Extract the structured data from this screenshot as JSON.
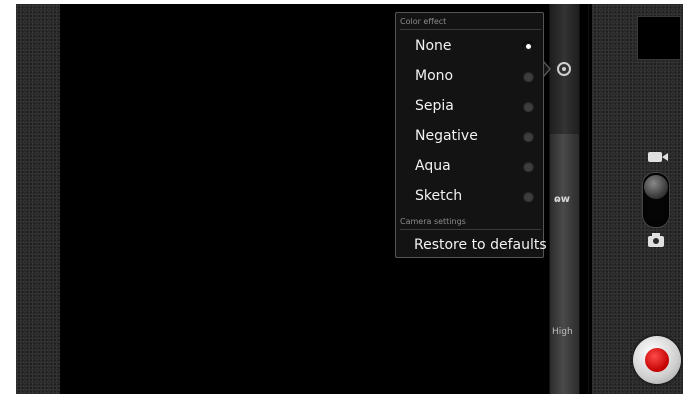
{
  "menu": {
    "section_color_effect": "Color effect",
    "color_effects": [
      {
        "label": "None",
        "selected": true
      },
      {
        "label": "Mono",
        "selected": false
      },
      {
        "label": "Sepia",
        "selected": false
      },
      {
        "label": "Negative",
        "selected": false
      },
      {
        "label": "Aqua",
        "selected": false
      },
      {
        "label": "Sketch",
        "selected": false
      }
    ],
    "section_camera_settings": "Camera settings",
    "restore_label": "Restore to defaults"
  },
  "side_strip": {
    "settings_icon": "settings-icon",
    "wb_icon_text": "ɷw",
    "quality_label": "High"
  },
  "controls": {
    "thumbnail": "last-capture-thumbnail",
    "video_mode_icon": "video-camera-icon",
    "camera_mode_icon": "camera-icon",
    "shutter_color": "#d00000"
  }
}
